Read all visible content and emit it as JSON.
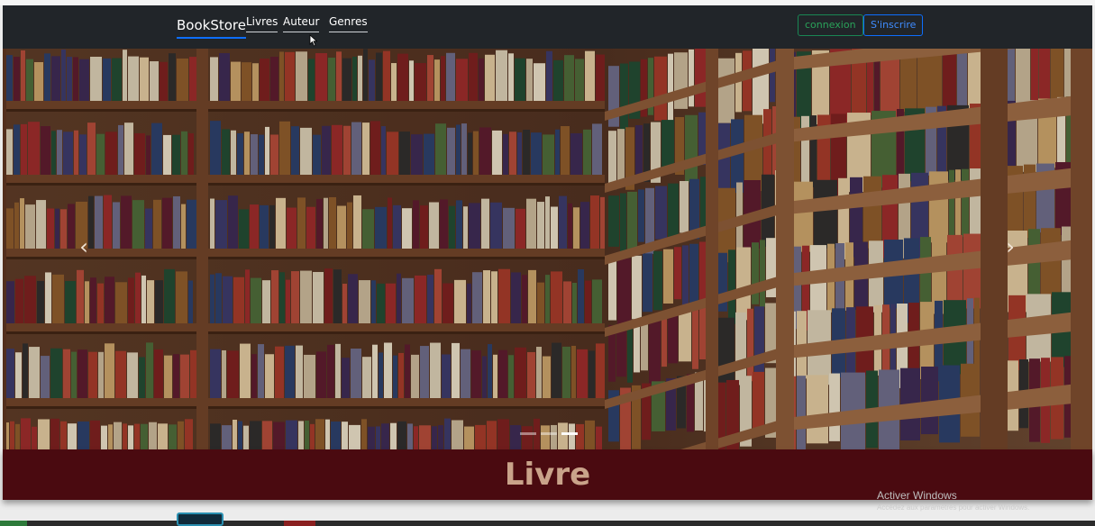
{
  "navbar": {
    "brand": "BookStore",
    "links": [
      {
        "label": "Livres"
      },
      {
        "label": "Auteur"
      },
      {
        "label": "Genres"
      }
    ],
    "login_label": "connexion",
    "signup_label": "S'inscrire"
  },
  "carousel": {
    "image": "bookshelf-photo",
    "prev_icon": "chevron-left-icon",
    "next_icon": "chevron-right-icon",
    "slide_count": 3,
    "active_slide": 3
  },
  "banner": {
    "title": "Livre"
  },
  "os_watermark": {
    "title": "Activer Windows",
    "subtitle": "Accédez aux paramètres pour activer Windows."
  },
  "colors": {
    "navbar_bg": "#212529",
    "banner_bg": "#4a0a10",
    "banner_text": "#c9a38a",
    "login_green": "#198754",
    "signup_blue": "#0d6efd"
  }
}
